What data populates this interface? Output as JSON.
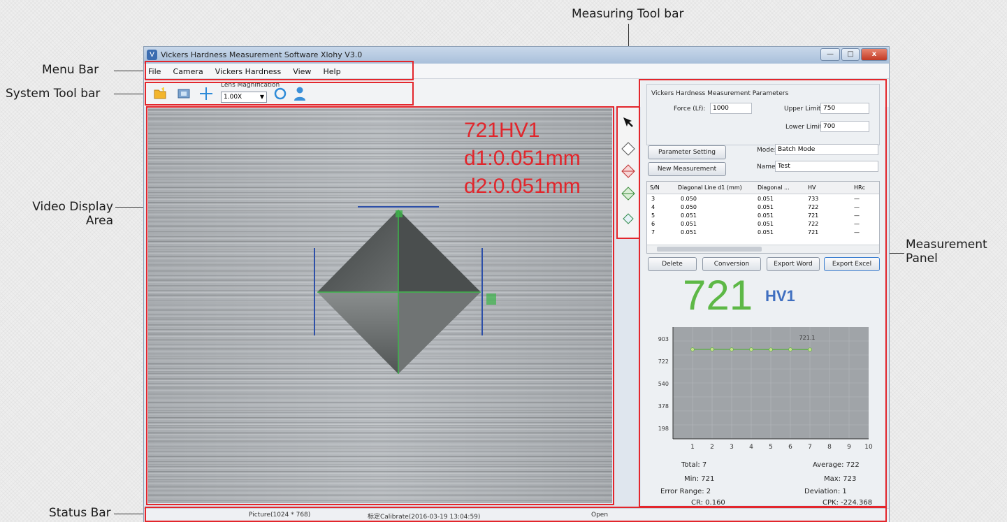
{
  "annotations": {
    "menu_bar": "Menu Bar",
    "system_tool_bar": "System Tool bar",
    "video_display_line1": "Video Display",
    "video_display_line2": "Area",
    "measuring_tool_bar": "Measuring Tool bar",
    "measurement_panel_line1": "Measurement",
    "measurement_panel_line2": "Panel",
    "status_bar": "Status Bar"
  },
  "window": {
    "title": "Vickers Hardness Measurement Software Xlohy V3.0",
    "controls": {
      "minimize": "—",
      "maximize": "□",
      "close": "x"
    }
  },
  "menu": [
    "File",
    "Camera",
    "Vickers Hardness",
    "View",
    "Help"
  ],
  "toolbar": {
    "lens_label": "Lens Magnification",
    "lens_value": "1.00X",
    "icons": [
      "open-file-icon",
      "capture-icon",
      "crosshair-icon",
      "calibrate-icon",
      "user-icon"
    ]
  },
  "video": {
    "hv": "721HV1",
    "d1": "d1:0.051mm",
    "d2": "d2:0.051mm"
  },
  "measuring_tools": [
    "pointer-icon",
    "diamond-icon",
    "diamond-red-icon",
    "diamond-green-icon",
    "diamond-small-icon"
  ],
  "panel": {
    "group_title": "Vickers Hardness Measurement Parameters",
    "force_label": "Force (Lf):",
    "force_value": "1000",
    "upper_label": "Upper Limit:",
    "upper_value": "750",
    "lower_label": "Lower Limit:",
    "lower_value": "700",
    "param_button": "Parameter Setting",
    "new_button": "New Measurement",
    "mode_label": "Mode:",
    "mode_value": "Batch Mode",
    "name_label": "Name:",
    "name_value": "Test",
    "table": {
      "headers": [
        "S/N",
        "Diagonal Line d1 (mm)",
        "Diagonal ...",
        "HV",
        "HRc"
      ],
      "rows": [
        [
          "3",
          "0.050",
          "0.051",
          "733",
          "—"
        ],
        [
          "4",
          "0.050",
          "0.051",
          "722",
          "—"
        ],
        [
          "5",
          "0.051",
          "0.051",
          "721",
          "—"
        ],
        [
          "6",
          "0.051",
          "0.051",
          "722",
          "—"
        ],
        [
          "7",
          "0.051",
          "0.051",
          "721",
          "—"
        ]
      ]
    },
    "delete_button": "Delete",
    "conversion_button": "Conversion",
    "export_word_button": "Export Word",
    "export_excel_button": "Export Excel",
    "big_value": "721",
    "big_unit": "HV1",
    "stats": {
      "total": "Total: 7",
      "min": "Min: 721",
      "error_range": "Error Range: 2",
      "cr": "CR: 0.160",
      "average": "Average: 722",
      "max": "Max: 723",
      "deviation": "Deviation: 1",
      "cpk": "CPK: -224.368"
    }
  },
  "chart_data": {
    "type": "line",
    "x": [
      1,
      2,
      3,
      4,
      5,
      6,
      7
    ],
    "y": [
      722,
      723,
      722,
      722,
      721,
      722,
      721
    ],
    "xticks": [
      "1",
      "2",
      "3",
      "4",
      "5",
      "6",
      "7",
      "8",
      "9",
      "10"
    ],
    "yticks": [
      "903",
      "722",
      "540",
      "378",
      "198"
    ],
    "ylim": [
      0,
      903
    ],
    "xlim": [
      0,
      10
    ],
    "annotation": "721.1",
    "grid": true,
    "colors": {
      "plot_bg": "#a0a4a8",
      "line": "#55b03a",
      "point": "#c8e08c"
    }
  },
  "status": {
    "picture": "Picture(1024 * 768)",
    "calibrate": "标定Calibrate(2016-03-19 13:04:59)",
    "open": "Open"
  },
  "colors": {
    "highlight": "#e3262c",
    "hv_text": "#e1262c",
    "big_value": "#5db846",
    "big_unit": "#3f6fc0"
  }
}
